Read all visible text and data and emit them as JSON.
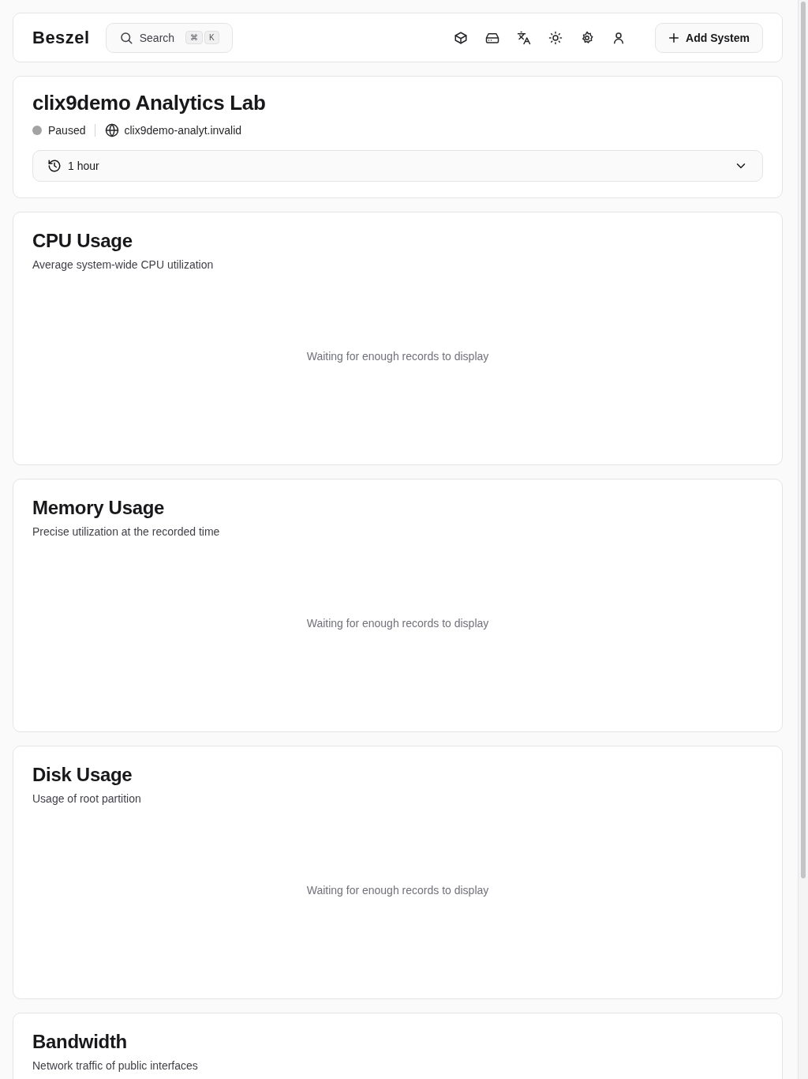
{
  "header": {
    "logo": "Beszel",
    "search": {
      "placeholder": "Search",
      "keys": [
        "⌘",
        "K"
      ]
    },
    "add_button": "Add System"
  },
  "system": {
    "name": "clix9demo Analytics Lab",
    "status": {
      "label": "Paused",
      "kind": "paused"
    },
    "host": "clix9demo-analyt.invalid",
    "range": "1 hour"
  },
  "charts": [
    {
      "title": "CPU Usage",
      "subtitle": "Average system-wide CPU utilization",
      "message": "Waiting for enough records to display"
    },
    {
      "title": "Memory Usage",
      "subtitle": "Precise utilization at the recorded time",
      "message": "Waiting for enough records to display"
    },
    {
      "title": "Disk Usage",
      "subtitle": "Usage of root partition",
      "message": "Waiting for enough records to display"
    },
    {
      "title": "Bandwidth",
      "subtitle": "Network traffic of public interfaces"
    }
  ]
}
